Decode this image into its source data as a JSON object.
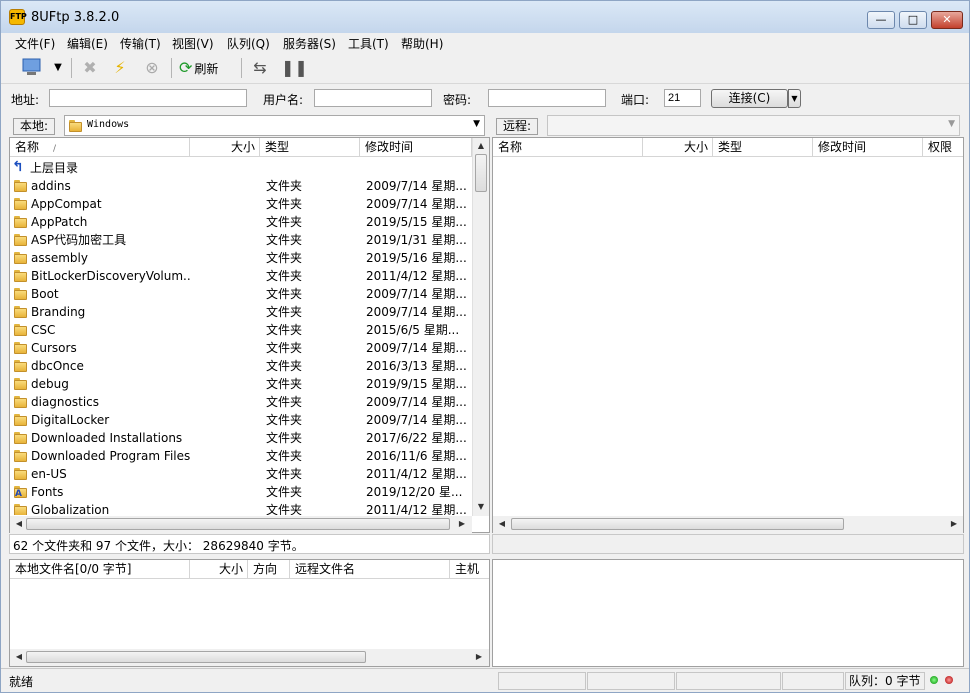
{
  "window": {
    "title": "8UFtp 3.8.2.0",
    "app_icon_text": "FTP"
  },
  "titlebar_buttons": {
    "minimize": "—",
    "maximize": "□",
    "close": "✕"
  },
  "menu": [
    "文件(F)",
    "编辑(E)",
    "传输(T)",
    "视图(V)",
    "队列(Q)",
    "服务器(S)",
    "工具(T)",
    "帮助(H)"
  ],
  "toolbar": {
    "refresh_label": "刷新"
  },
  "connection": {
    "address_label": "地址:",
    "address_value": "",
    "user_label": "用户名:",
    "user_value": "",
    "password_label": "密码:",
    "password_value": "",
    "port_label": "端口:",
    "port_value": "21",
    "connect_label": "连接(C)"
  },
  "local": {
    "label": "本地:",
    "path": "Windows",
    "columns": [
      "名称",
      "大小",
      "类型",
      "修改时间"
    ],
    "sort_indicator": "/",
    "parent_row": "上层目录",
    "rows": [
      {
        "name": "addins",
        "type": "文件夹",
        "mtime": "2009/7/14 星期..."
      },
      {
        "name": "AppCompat",
        "type": "文件夹",
        "mtime": "2009/7/14 星期..."
      },
      {
        "name": "AppPatch",
        "type": "文件夹",
        "mtime": "2019/5/15 星期..."
      },
      {
        "name": "ASP代码加密工具",
        "type": "文件夹",
        "mtime": "2019/1/31 星期..."
      },
      {
        "name": "assembly",
        "type": "文件夹",
        "mtime": "2019/5/16 星期..."
      },
      {
        "name": "BitLockerDiscoveryVolum...",
        "type": "文件夹",
        "mtime": "2011/4/12 星期..."
      },
      {
        "name": "Boot",
        "type": "文件夹",
        "mtime": "2009/7/14 星期..."
      },
      {
        "name": "Branding",
        "type": "文件夹",
        "mtime": "2009/7/14 星期..."
      },
      {
        "name": "CSC",
        "type": "文件夹",
        "mtime": "2015/6/5 星期..."
      },
      {
        "name": "Cursors",
        "type": "文件夹",
        "mtime": "2009/7/14 星期..."
      },
      {
        "name": "dbcOnce",
        "type": "文件夹",
        "mtime": "2016/3/13 星期..."
      },
      {
        "name": "debug",
        "type": "文件夹",
        "mtime": "2019/9/15 星期..."
      },
      {
        "name": "diagnostics",
        "type": "文件夹",
        "mtime": "2009/7/14 星期..."
      },
      {
        "name": "DigitalLocker",
        "type": "文件夹",
        "mtime": "2009/7/14 星期..."
      },
      {
        "name": "Downloaded Installations",
        "type": "文件夹",
        "mtime": "2017/6/22 星期..."
      },
      {
        "name": "Downloaded Program Files",
        "type": "文件夹",
        "mtime": "2016/11/6 星期..."
      },
      {
        "name": "en-US",
        "type": "文件夹",
        "mtime": "2011/4/12 星期..."
      },
      {
        "name": "Fonts",
        "type": "文件夹",
        "mtime": "2019/12/20 星..."
      },
      {
        "name": "Globalization",
        "type": "文件夹",
        "mtime": "2011/4/12 星期..."
      }
    ],
    "summary": "62 个文件夹和 97 个文件，大小： 28629840 字节。"
  },
  "remote": {
    "label": "远程:",
    "columns": [
      "名称",
      "大小",
      "类型",
      "修改时间",
      "权限"
    ]
  },
  "queue": {
    "columns": [
      "本地文件名[0/0 字节]",
      "大小",
      "方向",
      "远程文件名",
      "主机"
    ]
  },
  "status": {
    "text": "就绪",
    "queue_text": "队列：0 字节"
  }
}
